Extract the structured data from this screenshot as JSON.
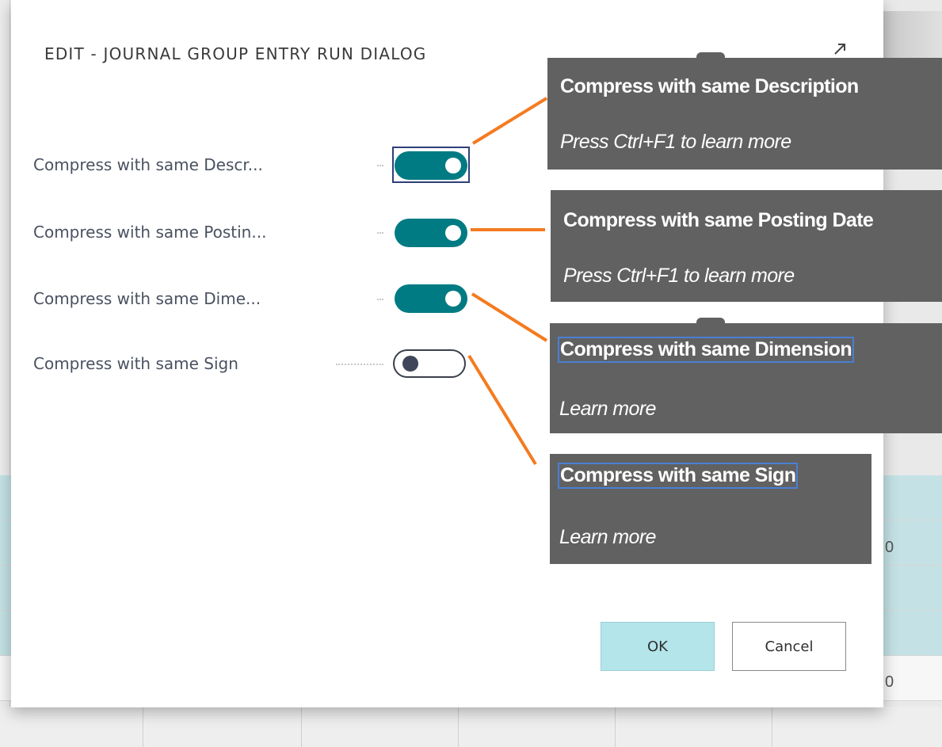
{
  "dialog": {
    "title": "EDIT - JOURNAL GROUP ENTRY RUN DIALOG",
    "expand_icon": "expand-diagonal-arrow-icon"
  },
  "fields": [
    {
      "label": "Compress with same Descr...",
      "state": "on"
    },
    {
      "label": "Compress with same Postin...",
      "state": "on"
    },
    {
      "label": "Compress with same Dime...",
      "state": "on"
    },
    {
      "label": "Compress with same Sign",
      "state": "off"
    }
  ],
  "callouts": [
    {
      "title": "Compress with same Description",
      "subtitle": "Press Ctrl+F1 to learn more"
    },
    {
      "title": "Compress with same Posting Date",
      "subtitle": "Press Ctrl+F1 to learn more"
    },
    {
      "title": "Compress with same Dimension",
      "subtitle": "Learn more"
    },
    {
      "title": "Compress with same Sign",
      "subtitle": "Learn more"
    }
  ],
  "buttons": {
    "ok_label": "OK",
    "cancel_label": "Cancel"
  },
  "background": {
    "digit_1": "0",
    "digit_2": "0"
  },
  "colors": {
    "toggle_on": "#007b83",
    "ok_button": "#b3e5ea",
    "callout_bg": "#616161",
    "connector": "#f47b20",
    "focus_border": "#4a7fd4"
  }
}
